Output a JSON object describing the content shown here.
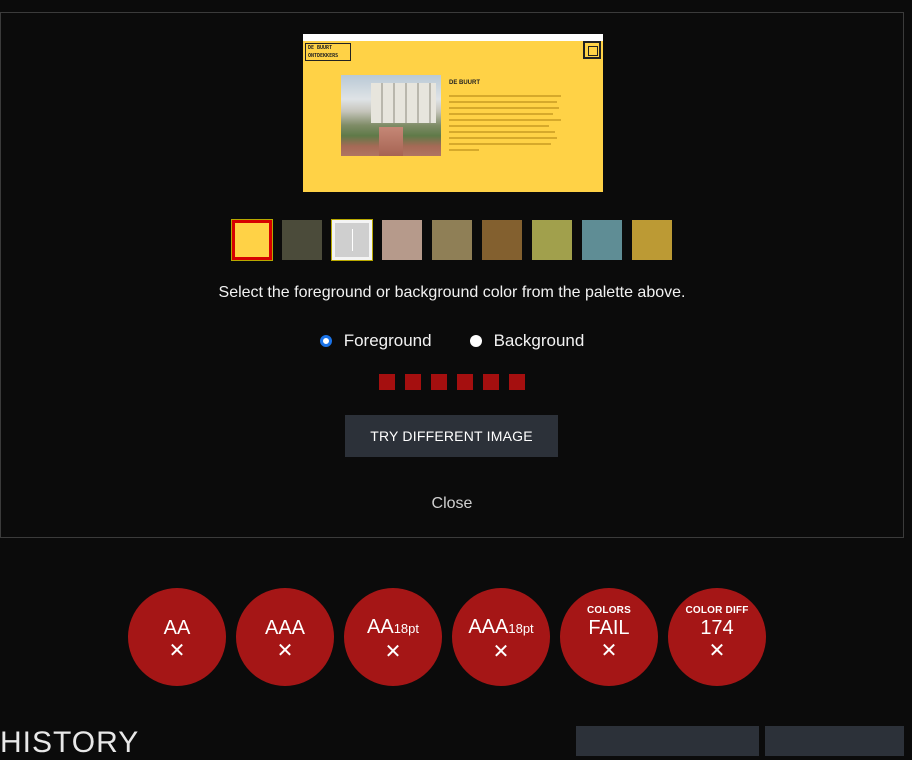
{
  "preview": {
    "logo_line1": "DE BUURT",
    "logo_line2": "ONTDEKKERS",
    "title": "DE BUURT"
  },
  "palette": {
    "colors": [
      "#ffd246",
      "#4b4b3a",
      "#cfcfcf",
      "#b69a8b",
      "#8f7f56",
      "#83602f",
      "#a1a04c",
      "#5f8d95",
      "#bc9a34"
    ],
    "selected_foreground_index": 0,
    "selected_background_index": 2
  },
  "instruction": "Select the foreground or background color from the palette above.",
  "radios": {
    "foreground_label": "Foreground",
    "background_label": "Background",
    "selected": "Foreground"
  },
  "try_button_label": "TRY DIFFERENT IMAGE",
  "close_label": "Close",
  "results": [
    {
      "small": "",
      "main": "AA",
      "sub": "",
      "mark": "✕"
    },
    {
      "small": "",
      "main": "AAA",
      "sub": "",
      "mark": "✕"
    },
    {
      "small": "",
      "main": "AA",
      "sub": "18pt",
      "mark": "✕"
    },
    {
      "small": "",
      "main": "AAA",
      "sub": "18pt",
      "mark": "✕"
    },
    {
      "small": "COLORS",
      "main": "FAIL",
      "sub": "",
      "mark": "✕"
    },
    {
      "small": "COLOR DIFF",
      "main": "174",
      "sub": "",
      "mark": "✕"
    }
  ],
  "history_title": "HISTORY"
}
